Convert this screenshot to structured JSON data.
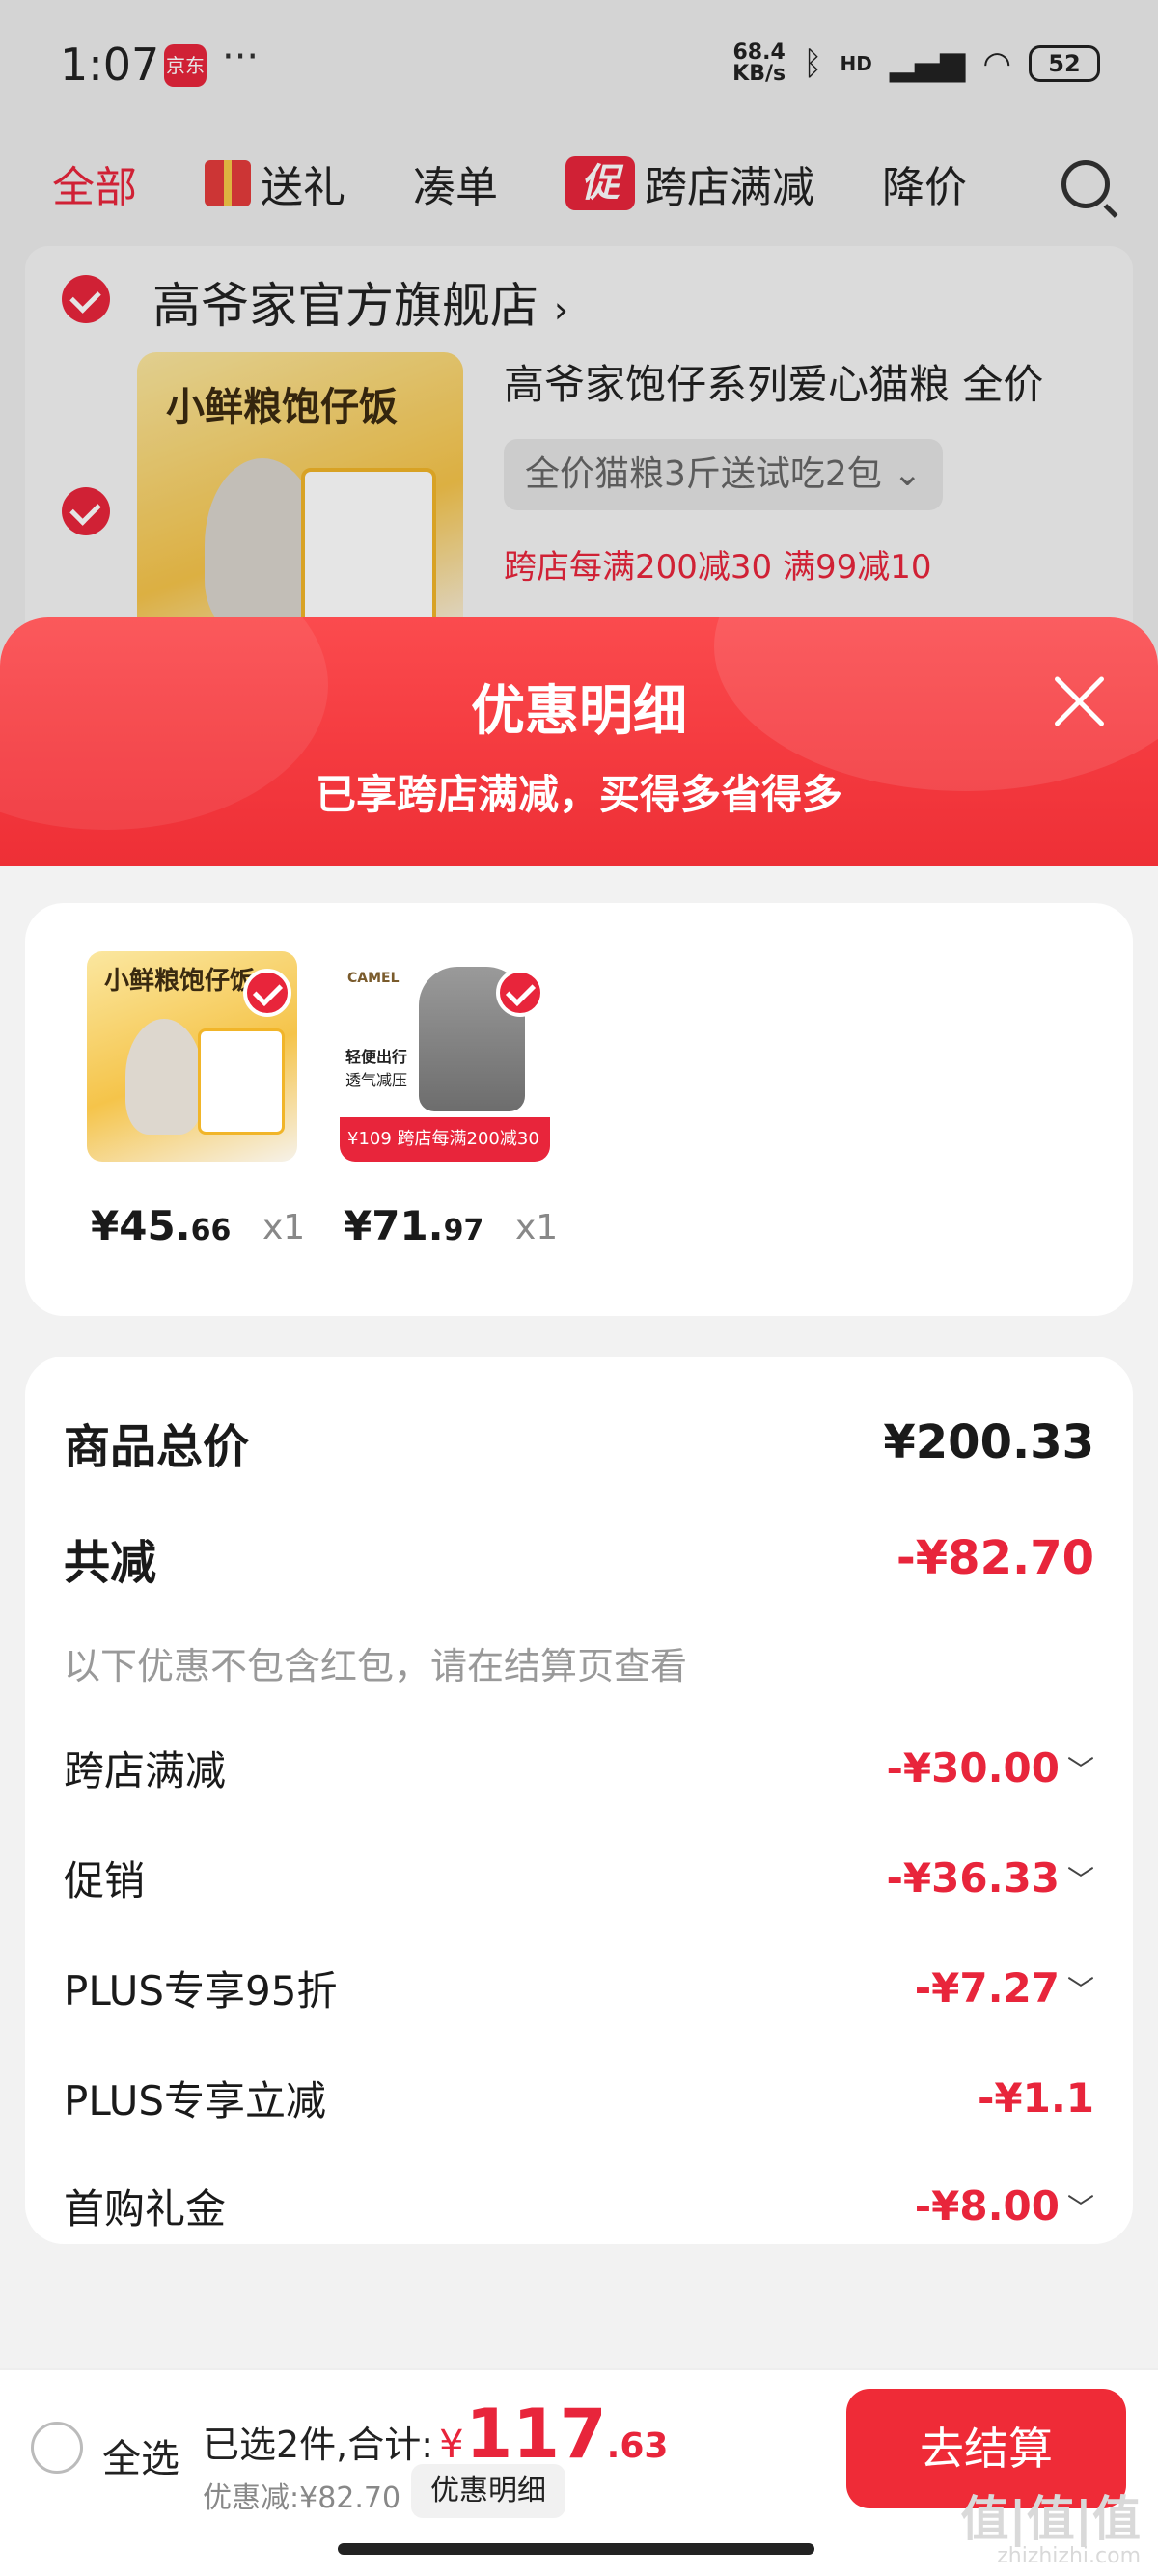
{
  "status_bar": {
    "time": "1:07",
    "app_icon_text": "京东",
    "dots": "···",
    "net_speed": "68.4",
    "net_unit": "KB/s",
    "signal_text": "HD",
    "battery": "52"
  },
  "tabs": [
    {
      "label": "全部"
    },
    {
      "label": "送礼"
    },
    {
      "label": "凑单"
    },
    {
      "label": "跨店满减",
      "badge": "促"
    },
    {
      "label": "降价"
    }
  ],
  "store": {
    "name": "高爷家官方旗舰店",
    "arrow": "›",
    "product_thumb_text": "小鲜粮饱仔饭",
    "product_title": "高爷家饱仔系列爱心猫粮 全价",
    "sku": "全价猫粮3斤送试吃2包 ⌄",
    "promo": "跨店每满200减30   满99减10"
  },
  "sheet": {
    "title": "优惠明细",
    "subtitle": "已享跨店满减，买得多省得多"
  },
  "items": [
    {
      "image_text": "小鲜粮饱仔饭",
      "price_int": "¥45.",
      "price_dec": "66",
      "qty": "x1"
    },
    {
      "brand": "CAMEL",
      "image_text1": "轻便出行",
      "image_text2": "透气减压",
      "banner": "¥109 跨店每满200减30",
      "price_int": "¥71.",
      "price_dec": "97",
      "qty": "x1"
    }
  ],
  "breakdown": {
    "total_label": "商品总价",
    "total_value": "¥200.33",
    "reduce_label": "共减",
    "reduce_value": "-¥82.70",
    "note": "以下优惠不包含红包，请在结算页查看",
    "rows": [
      {
        "label": "跨店满减",
        "value": "-¥30.00",
        "chevron": "﹀"
      },
      {
        "label": "促销",
        "value": "-¥36.33",
        "chevron": "﹀"
      },
      {
        "label": "PLUS专享95折",
        "value": "-¥7.27",
        "chevron": "﹀"
      },
      {
        "label": "PLUS专享立减",
        "value": "-¥1.1",
        "chevron": ""
      },
      {
        "label": "首购礼金",
        "value": "-¥8.00",
        "chevron": "﹀"
      }
    ]
  },
  "bottom_bar": {
    "select_all": "全选",
    "selected_text": "已选2件,合计:",
    "currency": "¥",
    "total_int": "117",
    "total_dec": ".63",
    "discount_text": "优惠减:¥82.70",
    "detail_button": "优惠明细",
    "checkout_button": "去结算"
  },
  "watermark": {
    "line1": "值|值|值",
    "line2": "zhizhizhi.com"
  },
  "colors": {
    "accent": "#e8253b",
    "sheet_header": "#f43a3f",
    "checkout": "#ef2b37"
  }
}
